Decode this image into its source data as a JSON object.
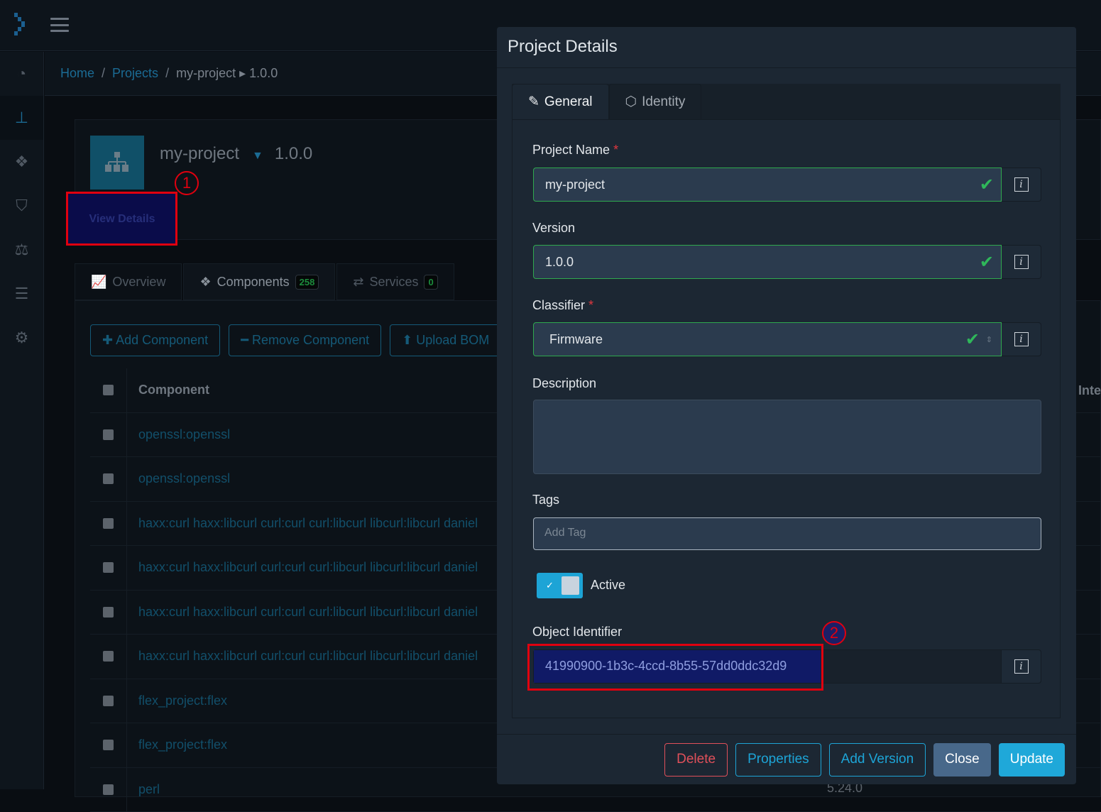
{
  "breadcrumb": {
    "home": "Home",
    "projects": "Projects",
    "project": "my-project",
    "arrow": "▸",
    "version": "1.0.0",
    "sep": "/"
  },
  "project": {
    "name": "my-project",
    "version": "1.0.0",
    "view_details": "View Details"
  },
  "annotations": {
    "first": "1",
    "second": "2"
  },
  "tabs": [
    {
      "label": "Overview"
    },
    {
      "label": "Components",
      "count": "258"
    },
    {
      "label": "Services",
      "count": "0"
    }
  ],
  "actions": {
    "add": "Add Component",
    "remove": "Remove Component",
    "upload": "Upload BOM"
  },
  "table": {
    "header": "Component",
    "extra_header": "Inte",
    "rows": [
      "openssl:openssl",
      "openssl:openssl",
      "haxx:curl haxx:libcurl curl:curl curl:libcurl libcurl:libcurl daniel",
      "haxx:curl haxx:libcurl curl:curl curl:libcurl libcurl:libcurl daniel",
      "haxx:curl haxx:libcurl curl:curl curl:libcurl libcurl:libcurl daniel",
      "haxx:curl haxx:libcurl curl:curl curl:libcurl libcurl:libcurl daniel",
      "flex_project:flex",
      "flex_project:flex",
      "perl"
    ],
    "partial_version": "5.24.0"
  },
  "modal": {
    "title": "Project Details",
    "tabs": {
      "general": "General",
      "identity": "Identity"
    },
    "fields": {
      "name_label": "Project Name",
      "name_value": "my-project",
      "version_label": "Version",
      "version_value": "1.0.0",
      "classifier_label": "Classifier",
      "classifier_value": "Firmware",
      "description_label": "Description",
      "description_value": "",
      "tags_label": "Tags",
      "tags_placeholder": "Add Tag",
      "active_label": "Active",
      "active": true,
      "oid_label": "Object Identifier",
      "oid_value": "41990900-1b3c-4ccd-8b55-57dd0ddc32d9"
    },
    "required_mark": "*",
    "buttons": {
      "delete": "Delete",
      "properties": "Properties",
      "add_version": "Add Version",
      "close": "Close",
      "update": "Update"
    }
  },
  "colors": {
    "accent": "#1fa8d9",
    "valid": "#2fb75a",
    "danger": "#e0505a",
    "annotation": "#e0000f"
  }
}
